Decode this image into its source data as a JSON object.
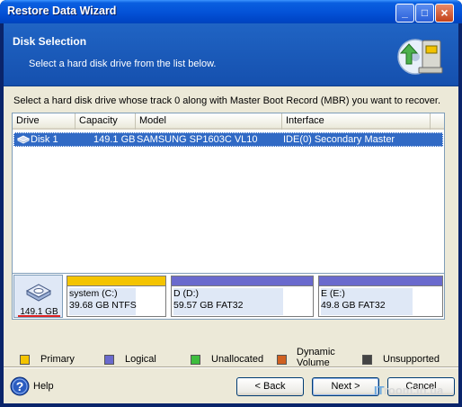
{
  "window": {
    "title": "Restore Data Wizard",
    "buttons": {
      "minimize": "_",
      "maximize": "□",
      "close": "×"
    }
  },
  "header": {
    "title": "Disk Selection",
    "subtitle": "Select a hard disk drive from the list below.",
    "icon": "disk-restore-icon"
  },
  "instruction": "Select a hard disk drive whose track 0 along with Master Boot Record (MBR) you want to recover.",
  "list": {
    "columns": [
      "Drive",
      "Capacity",
      "Model",
      "Interface"
    ],
    "rows": [
      {
        "drive": "Disk 1",
        "capacity": "149.1 GB",
        "model": "SAMSUNG SP1603C VL10",
        "interface": "IDE(0) Secondary Master",
        "selected": true
      }
    ]
  },
  "diskmap": {
    "disk_size": "149.1 GB",
    "partitions": [
      {
        "name": "system (C:)",
        "info": "39.68 GB  NTFS",
        "bar_color": "#f4c400"
      },
      {
        "name": "D (D:)",
        "info": "59.57 GB  FAT32",
        "bar_color": "#6a6acd"
      },
      {
        "name": "E (E:)",
        "info": "49.8 GB  FAT32",
        "bar_color": "#6a6acd"
      }
    ]
  },
  "legend": [
    {
      "label": "Primary",
      "color": "#f4c400"
    },
    {
      "label": "Logical",
      "color": "#6a6acd"
    },
    {
      "label": "Unallocated",
      "color": "#3ebd3e"
    },
    {
      "label": "Dynamic\nVolume",
      "color": "#d06020"
    },
    {
      "label": "Unsupported",
      "color": "#444444"
    }
  ],
  "footer": {
    "help": "Help",
    "back": "< Back",
    "next": "Next >",
    "cancel": "Cancel",
    "watermark_prefix": "IT",
    "watermark_text": "room.in.ua"
  }
}
